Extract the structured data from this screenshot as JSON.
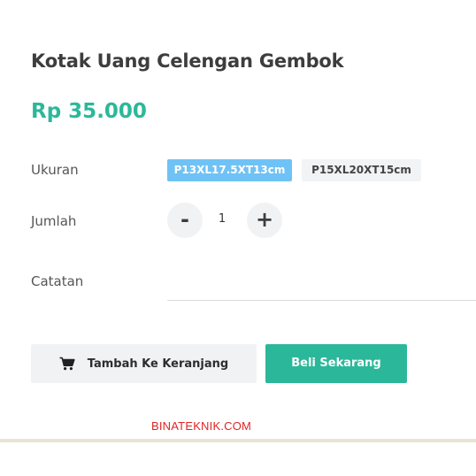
{
  "product": {
    "title": "Kotak Uang Celengan Gembok",
    "price": "Rp 35.000"
  },
  "size": {
    "label": "Ukuran",
    "options": [
      "P13XL17.5XT13cm",
      "P15XL20XT15cm"
    ],
    "selected": "P13XL17.5XT13cm"
  },
  "quantity": {
    "label": "Jumlah",
    "minus": "-",
    "value": "1",
    "plus": "+"
  },
  "note": {
    "label": "Catatan",
    "value": ""
  },
  "actions": {
    "cart_label": "Tambah Ke Keranjang",
    "cart_icon": "shopping-cart-icon",
    "buy_label": "Beli Sekarang"
  },
  "watermark": "BINATEKNIK.COM",
  "colors": {
    "accent": "#2bb89a",
    "selected_option": "#6fc2f5",
    "watermark": "#e02424"
  }
}
